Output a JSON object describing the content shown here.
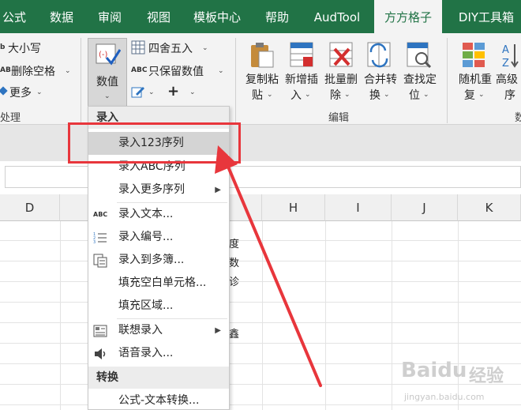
{
  "tabs": [
    "公式",
    "数据",
    "审阅",
    "视图",
    "模板中心",
    "帮助",
    "AudTool",
    "方方格子",
    "DIY工具箱"
  ],
  "active_tab": "方方格子",
  "ribbon": {
    "left_items": [
      "大小写",
      "删除空格",
      "更多"
    ],
    "left_group": "处理",
    "numeric_button": "数值",
    "round_item": "四舍五入",
    "keep_values_item": "只保留数值",
    "plus_symbol": "+",
    "edit_buttons": [
      {
        "line1": "复制粘",
        "line2": "贴"
      },
      {
        "line1": "新增插",
        "line2": "入"
      },
      {
        "line1": "批量删",
        "line2": "除"
      },
      {
        "line1": "合并转",
        "line2": "换"
      },
      {
        "line1": "查找定",
        "line2": "位"
      }
    ],
    "edit_group": "编辑",
    "more_buttons": [
      {
        "line1": "随机重",
        "line2": "复"
      },
      {
        "line1": "高级",
        "line2": "序"
      }
    ],
    "right_group_partial": "数"
  },
  "sheet": {
    "columns": [
      "D",
      "H",
      "I",
      "J",
      "K"
    ],
    "cell_chars": [
      "度",
      "数",
      "诊",
      "鑫"
    ]
  },
  "menu": {
    "sections": [
      "录入",
      "转换"
    ],
    "items": [
      {
        "label": "录入123序列",
        "highlighted": true
      },
      {
        "label": "录入ABC序列"
      },
      {
        "label": "录入更多序列",
        "submenu": true
      },
      {
        "label": "录入文本...",
        "icon": "abc-text-icon"
      },
      {
        "label": "录入编号...",
        "icon": "numbered-list-icon"
      },
      {
        "label": "录入到多簿...",
        "icon": "multi-book-icon"
      },
      {
        "label": "填充空白单元格..."
      },
      {
        "label": "填充区域..."
      },
      {
        "label": "联想录入",
        "icon": "associative-input-icon",
        "submenu": true
      },
      {
        "label": "语音录入...",
        "icon": "speaker-icon"
      },
      {
        "label": "公式-文本转换..."
      }
    ]
  },
  "watermark": {
    "brand": "Baidu",
    "sub": "经验",
    "domain": "jingyan.baidu.com"
  },
  "colors": {
    "tab_bar": "#217346",
    "annotation_red": "#e8363c",
    "highlight": "#d4d4d4"
  }
}
